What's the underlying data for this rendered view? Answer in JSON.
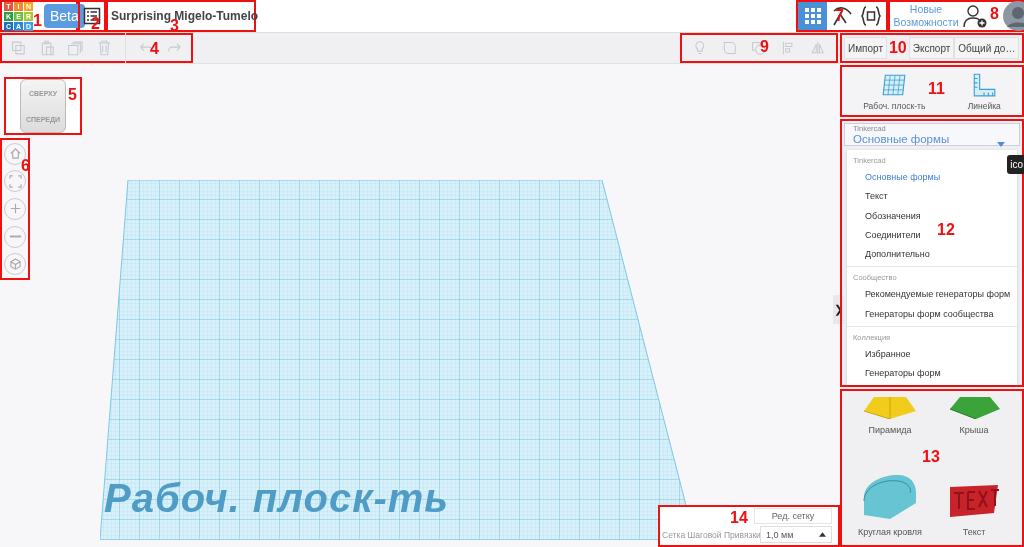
{
  "header": {
    "callout_logo": "1",
    "logo_letters": [
      "T",
      "I",
      "N",
      "K",
      "E",
      "R",
      "C",
      "A",
      "D"
    ],
    "beta": "Beta",
    "callout_list": "2",
    "title": "Surprising Migelo-Tumelo",
    "callout_title": "3",
    "views": [
      {
        "kind": "grid",
        "selected": true
      },
      {
        "kind": "pickaxe",
        "selected": false
      },
      {
        "kind": "code",
        "selected": false
      }
    ],
    "callout_views": "7",
    "new_features": "Новые Возможности",
    "callout_account": "8"
  },
  "edit_tools": {
    "callout": "4",
    "items": [
      {
        "kind": "copy",
        "disabled": true
      },
      {
        "kind": "paste",
        "disabled": true
      },
      {
        "kind": "duplicate",
        "disabled": true
      },
      {
        "kind": "delete",
        "disabled": true
      },
      {
        "kind": "undo",
        "disabled": true
      },
      {
        "kind": "redo",
        "disabled": true
      }
    ]
  },
  "shape_tools": {
    "callout": "9",
    "items": [
      {
        "kind": "bulb",
        "disabled": true
      },
      {
        "kind": "note",
        "disabled": true
      },
      {
        "kind": "group",
        "disabled": true
      },
      {
        "kind": "align",
        "disabled": true
      },
      {
        "kind": "mirror",
        "disabled": true
      }
    ]
  },
  "file_actions": {
    "callout": "10",
    "buttons": [
      "Импорт",
      "Экспорт",
      "Общий до…"
    ]
  },
  "view_cube": {
    "callout": "5",
    "top": "СВЕРХУ",
    "front": "СПЕРЕДИ"
  },
  "navigation": {
    "callout": "6",
    "items": [
      {
        "kind": "home"
      },
      {
        "kind": "fit"
      },
      {
        "kind": "zoom-in"
      },
      {
        "kind": "zoom-out"
      },
      {
        "kind": "perspective"
      }
    ]
  },
  "workplane": {
    "label": "Рабоч. плоск-ть"
  },
  "snap_grid": {
    "callout": "14",
    "edit_button": "Ред. сетку",
    "label": "Сетка Шаговой Привязки",
    "value": "1,0 мм"
  },
  "collapse_toggle": "❯",
  "place_tools": {
    "callout": "11",
    "items": [
      {
        "kind": "workplane",
        "label": "Рабоч. плоск-ть"
      },
      {
        "kind": "ruler",
        "label": "Линейка"
      }
    ]
  },
  "library": {
    "callout": "12",
    "label": "Tinkercad",
    "value": "Основные формы",
    "tooltip": "ico",
    "sections": [
      {
        "heading": "Tinkercad",
        "items": [
          {
            "label": "Основные формы",
            "selected": true
          },
          {
            "label": "Текст",
            "selected": false
          },
          {
            "label": "Обозначения",
            "selected": false
          },
          {
            "label": "Соединители",
            "selected": false
          },
          {
            "label": "Дополнительно",
            "selected": false
          }
        ]
      },
      {
        "heading": "Сообщество",
        "items": [
          {
            "label": "Рекомендуемые генераторы форм",
            "selected": false
          },
          {
            "label": "Генераторы форм сообщества",
            "selected": false
          }
        ]
      },
      {
        "heading": "Коллекция",
        "items": [
          {
            "label": "Избранное",
            "selected": false
          },
          {
            "label": "Генераторы форм",
            "selected": false
          }
        ]
      }
    ]
  },
  "shapes": {
    "callout": "13",
    "items": [
      {
        "kind": "pyramid",
        "label": "Пирамида"
      },
      {
        "kind": "roof",
        "label": "Крыша"
      },
      {
        "kind": "round-roof",
        "label": "Круглая кровля"
      },
      {
        "kind": "text",
        "label": "Текст"
      }
    ]
  }
}
